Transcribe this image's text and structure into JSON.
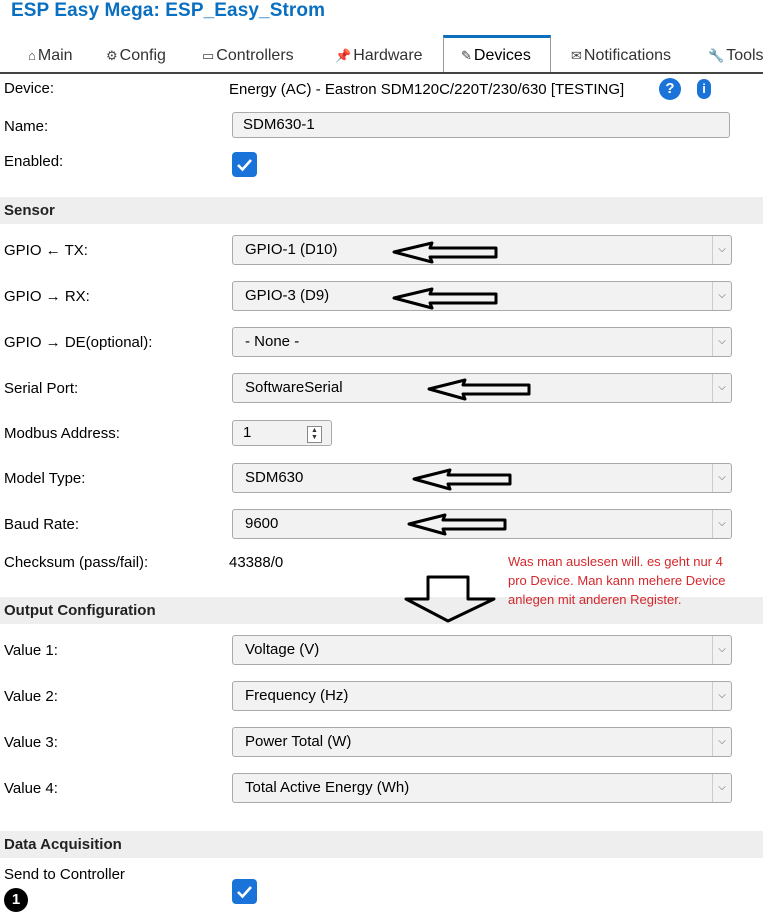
{
  "app_title": "ESP Easy Mega: ESP_Easy_Strom",
  "tabs": [
    {
      "label": "Main",
      "icon": "home-icon"
    },
    {
      "label": "Config",
      "icon": "gear-icon"
    },
    {
      "label": "Controllers",
      "icon": "chat-icon"
    },
    {
      "label": "Hardware",
      "icon": "pin-icon"
    },
    {
      "label": "Devices",
      "icon": "plug-icon"
    },
    {
      "label": "Notifications",
      "icon": "envelope-icon"
    },
    {
      "label": "Tools",
      "icon": "wrench-icon"
    }
  ],
  "device": {
    "label": "Device:",
    "value": "Energy (AC) - Eastron SDM120C/220T/230/630 [TESTING]",
    "help": "?",
    "info": "i"
  },
  "name": {
    "label": "Name:",
    "value": "SDM630-1"
  },
  "enabled": {
    "label": "Enabled:"
  },
  "sensor": {
    "heading": "Sensor",
    "gpio_tx": {
      "label": "GPIO ← TX:",
      "value": "GPIO-1 (D10)"
    },
    "gpio_rx": {
      "label": "GPIO → RX:",
      "value": "GPIO-3 (D9)"
    },
    "gpio_de": {
      "label": "GPIO → DE(optional):",
      "value": "- None -"
    },
    "serial_port": {
      "label": "Serial Port:",
      "value": "SoftwareSerial"
    },
    "modbus_address": {
      "label": "Modbus Address:",
      "value": "1"
    },
    "model_type": {
      "label": "Model Type:",
      "value": "SDM630"
    },
    "baud_rate": {
      "label": "Baud Rate:",
      "value": "9600"
    },
    "checksum": {
      "label": "Checksum (pass/fail):",
      "value": "43388/0"
    }
  },
  "annotation": "Was man auslesen will. es geht nur 4 pro Device. Man kann mehere Device anlegen mit anderen Register.",
  "output": {
    "heading": "Output Configuration",
    "values": [
      {
        "label": "Value 1:",
        "value": "Voltage (V)"
      },
      {
        "label": "Value 2:",
        "value": "Frequency (Hz)"
      },
      {
        "label": "Value 3:",
        "value": "Power Total (W)"
      },
      {
        "label": "Value 4:",
        "value": "Total Active Energy (Wh)"
      }
    ]
  },
  "data_acquisition": {
    "heading": "Data Acquisition",
    "send_label": "Send to Controller",
    "badge": "1"
  },
  "colors": {
    "accent": "#1a73d9",
    "title": "#0b6fc0",
    "annotation": "#d4282d"
  }
}
